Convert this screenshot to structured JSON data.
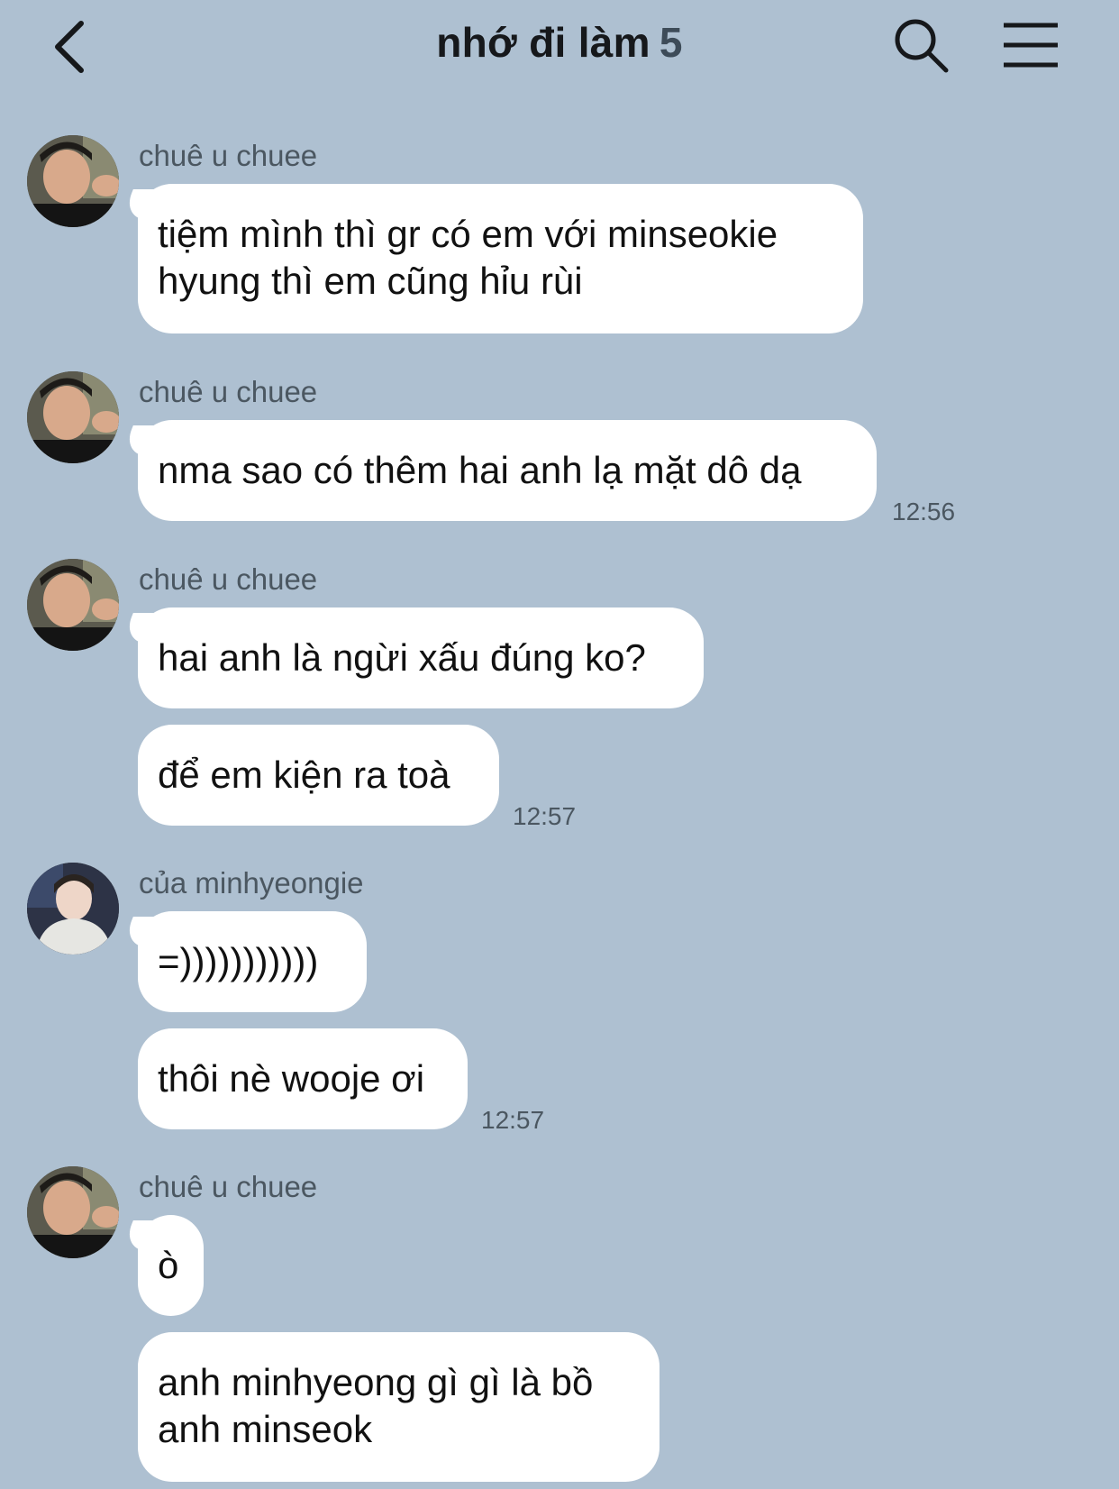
{
  "header": {
    "title": "nhớ đi làm",
    "member_count": "5",
    "back_icon": "chevron-left-icon",
    "search_icon": "search-icon",
    "menu_icon": "hamburger-menu-icon"
  },
  "colors": {
    "background": "#aec0d1",
    "bubble": "#ffffff",
    "meta_text": "#4b5761"
  },
  "messages": [
    {
      "sender": "chuê u chuee",
      "texts": [
        "tiệm mình thì gr có em với minseokie\nhyung thì em cũng hỉu rùi"
      ],
      "time": ""
    },
    {
      "sender": "chuê u chuee",
      "texts": [
        "nma sao có thêm hai anh lạ mặt dô dạ"
      ],
      "time": "12:56"
    },
    {
      "sender": "chuê u chuee",
      "texts": [
        "hai anh là ngừi xấu đúng ko?",
        "để em kiện ra toà"
      ],
      "time": "12:57"
    },
    {
      "sender": "của minhyeongie",
      "texts": [
        "=)))))))))))",
        "thôi nè wooje ơi"
      ],
      "time": "12:57"
    },
    {
      "sender": "chuê u chuee",
      "texts": [
        "ò",
        "anh minhyeong gì gì là bồ\nanh minseok"
      ],
      "time": ""
    }
  ]
}
